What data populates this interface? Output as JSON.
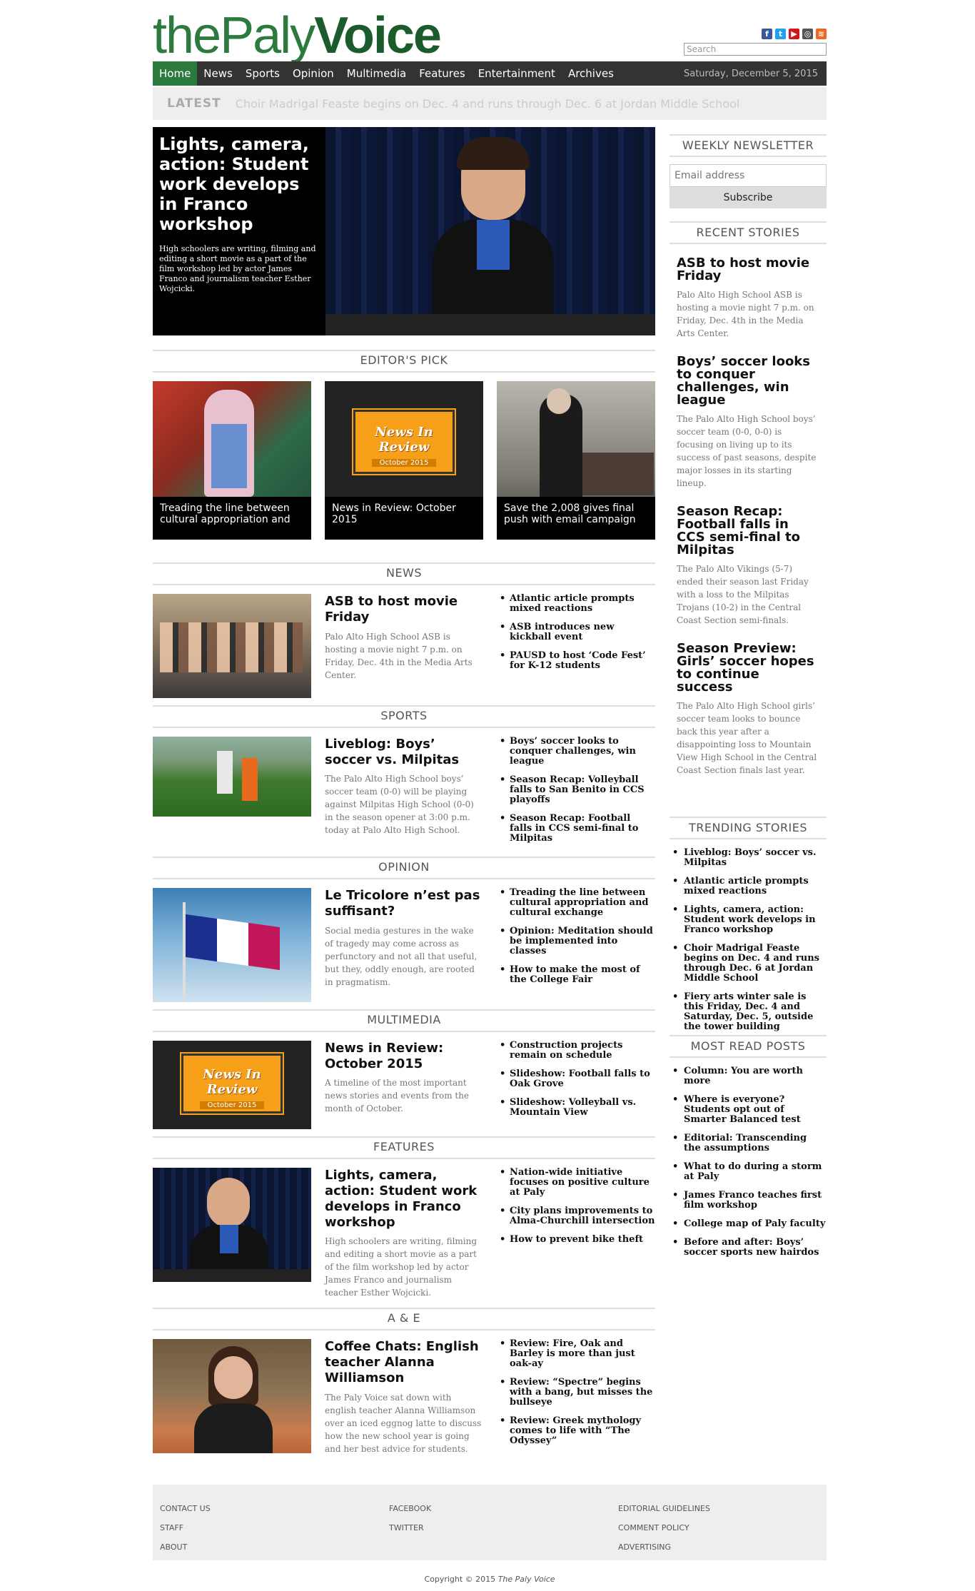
{
  "header": {
    "logo_the": "the",
    "logo_paly": "Paly",
    "logo_voice": "Voice",
    "search_placeholder": "Search",
    "social": [
      "facebook-icon",
      "twitter-icon",
      "youtube-icon",
      "instagram-icon",
      "rss-icon"
    ]
  },
  "nav": {
    "items": [
      "Home",
      "News",
      "Sports",
      "Opinion",
      "Multimedia",
      "Features",
      "Entertainment",
      "Archives"
    ],
    "date": "Saturday, December 5, 2015"
  },
  "latest": {
    "label": "LATEST",
    "text": "Choir Madrigal Feaste begins on Dec. 4 and runs through Dec. 6 at Jordan Middle School"
  },
  "hero": {
    "title": "Lights, camera, action: Student work develops in Franco workshop",
    "desc": "High schoolers are writing, filming and editing a short movie as a part of the film workshop led by actor James Franco and journalism teacher Esther Wojcicki."
  },
  "editors_pick": {
    "heading": "EDITOR'S PICK",
    "items": [
      "Treading the line between cultural appropriation and",
      "News in Review: October 2015",
      "Save the 2,008 gives final push with email campaign"
    ],
    "nir_title": "News In Review",
    "nir_sub": "October 2015"
  },
  "sections": [
    {
      "heading": "NEWS",
      "title": "ASB to host movie Friday",
      "desc": "Palo Alto High School ASB is hosting a movie night 7 p.m. on Friday, Dec. 4th in the Media Arts Center.",
      "bullets": [
        "Atlantic article prompts mixed reactions",
        "ASB introduces new kickball event",
        "PAUSD to host ‘Code Fest’ for K-12 students"
      ]
    },
    {
      "heading": "SPORTS",
      "title": "Liveblog: Boys’ soccer vs. Milpitas",
      "desc": "The Palo Alto High School boys’ soccer team (0-0) will be playing against Milpitas High School (0-0) in the season opener at 3:00 p.m. today at Palo Alto High School.",
      "bullets": [
        "Boys’ soccer looks to conquer challenges, win league",
        "Season Recap: Volleyball falls to San Benito in CCS playoffs",
        "Season Recap: Football falls in CCS semi-final to Milpitas"
      ]
    },
    {
      "heading": "OPINION",
      "title": "Le Tricolore n’est pas suffisant?",
      "desc": "Social media gestures in the wake of tragedy may come across as perfunctory and not all that useful, but they, oddly enough, are rooted in pragmatism.",
      "bullets": [
        "Treading the line between cultural appropriation and cultural exchange",
        "Opinion: Meditation should be implemented into classes",
        "How to make the most of the College Fair"
      ]
    },
    {
      "heading": "MULTIMEDIA",
      "title": "News in Review: October 2015",
      "desc": "A timeline of the most important news stories and events from the month of October.",
      "bullets": [
        "Construction projects remain on schedule",
        "Slideshow: Football falls to Oak Grove",
        "Slideshow: Volleyball vs. Mountain View"
      ]
    },
    {
      "heading": "FEATURES",
      "title": "Lights, camera, action: Student work develops in Franco workshop",
      "desc": "High schoolers are writing, filming and editing a short movie as a part of the film workshop led by actor James Franco and journalism teacher Esther Wojcicki.",
      "bullets": [
        "Nation-wide initiative focuses on positive culture at Paly",
        "City plans improvements to Alma-Churchill intersection",
        "How to prevent bike theft"
      ]
    },
    {
      "heading": "A & E",
      "title": "Coffee Chats: English teacher Alanna Williamson",
      "desc": "The Paly Voice sat down with english teacher Alanna Williamson over an iced eggnog latte to discuss how the new school year is going and her best advice for students.",
      "bullets": [
        "Review: Fire, Oak and Barley is more than just oak-ay",
        "Review: “Spectre” begins with a bang, but misses the bullseye",
        "Review: Greek mythology comes to life with “The Odyssey”"
      ]
    }
  ],
  "sidebar": {
    "newsletter_heading": "WEEKLY NEWSLETTER",
    "email_placeholder": "Email address",
    "subscribe_label": "Subscribe",
    "recent_heading": "RECENT STORIES",
    "recent": [
      {
        "title": "ASB to host movie Friday",
        "desc": "Palo Alto High School ASB is hosting a movie night 7 p.m. on Friday, Dec. 4th in the Media Arts Center."
      },
      {
        "title": "Boys’ soccer looks to conquer challenges, win league",
        "desc": "The Palo Alto High School boys’ soccer team (0-0, 0-0) is focusing on living up to its success of past seasons, despite major losses in its starting lineup."
      },
      {
        "title": "Season Recap: Football falls in CCS semi-final to Milpitas",
        "desc": "The Palo Alto Vikings (5-7) ended their season last Friday with a loss to the Milpitas Trojans (10-2) in the Central Coast Section semi-finals."
      },
      {
        "title": "Season Preview: Girls’ soccer hopes to continue success",
        "desc": "The Palo Alto High School girls’ soccer team looks to bounce back this year after a disappointing loss to Mountain View High School in the Central Coast Section finals last year."
      }
    ],
    "trending_heading": "TRENDING STORIES",
    "trending": [
      "Liveblog: Boys’ soccer vs. Milpitas",
      "Atlantic article prompts mixed reactions",
      "Lights, camera, action: Student work develops in Franco workshop",
      "Choir Madrigal Feaste begins on Dec. 4 and runs through Dec. 6 at Jordan Middle School",
      "Fiery arts winter sale is this Friday, Dec. 4 and Saturday, Dec. 5, outside the tower building"
    ],
    "mostread_heading": "MOST READ POSTS",
    "mostread": [
      "Column: You are worth more",
      "Where is everyone? Students opt out of Smarter Balanced test",
      "Editorial: Transcending the assumptions",
      "What to do during a storm at Paly",
      "James Franco teaches first film workshop",
      "College map of Paly faculty",
      "Before and after: Boys’ soccer sports new hairdos"
    ]
  },
  "footer": {
    "col1": [
      "CONTACT US",
      "STAFF",
      "ABOUT"
    ],
    "col2": [
      "FACEBOOK",
      "TWITTER"
    ],
    "col3": [
      "EDITORIAL GUIDELINES",
      "COMMENT POLICY",
      "ADVERTISING"
    ],
    "copyright": "Copyright © 2015",
    "copyright_brand": "The Paly Voice"
  }
}
